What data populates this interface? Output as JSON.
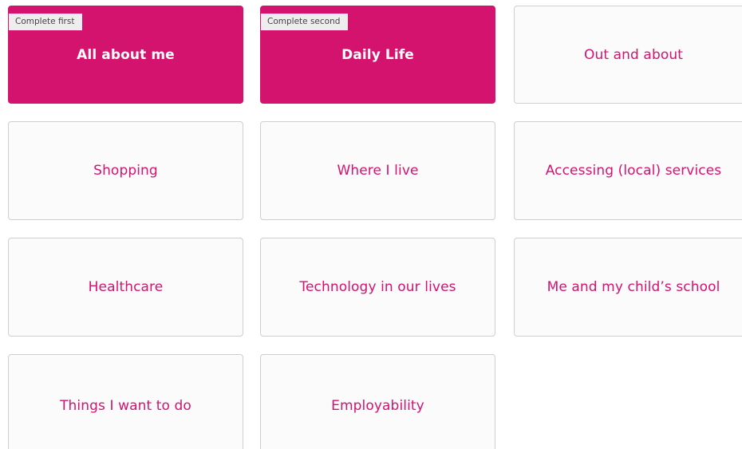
{
  "tiles": [
    {
      "label": "All about me",
      "badge": "Complete first",
      "highlighted": true
    },
    {
      "label": "Daily Life",
      "badge": "Complete second",
      "highlighted": true
    },
    {
      "label": "Out and about"
    },
    {
      "label": "Shopping"
    },
    {
      "label": "Where I live"
    },
    {
      "label": "Accessing (local) services"
    },
    {
      "label": "Healthcare"
    },
    {
      "label": "Technology in our lives"
    },
    {
      "label": "Me and my child’s school"
    },
    {
      "label": "Things I want to do"
    },
    {
      "label": "Employability"
    }
  ],
  "colors": {
    "accent": "#d4136f",
    "tile_background": "#fbfbfb",
    "tile_border": "#cfcfcf",
    "badge_background": "#eeeeee",
    "badge_text": "#444444"
  }
}
